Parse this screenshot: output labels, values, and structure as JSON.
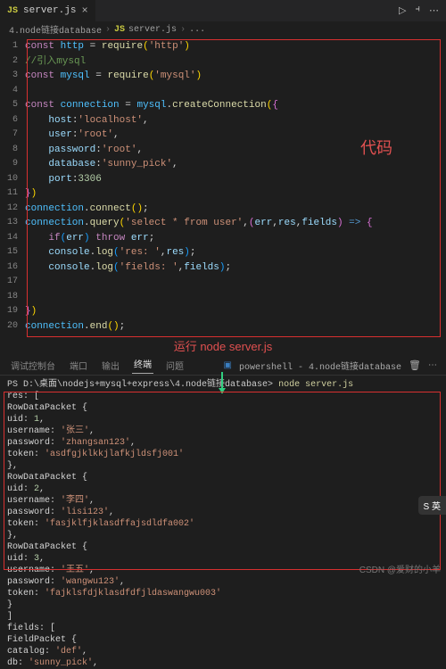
{
  "tab": {
    "filename": "server.js",
    "icon": "JS"
  },
  "breadcrumb": {
    "folder": "4.node链接database",
    "file": "server.js",
    "trail": "..."
  },
  "annotations": {
    "code_label": "代码",
    "run_label": "运行 node server.js"
  },
  "code_lines": [
    {
      "n": 1,
      "html": "<span class='kw'>const</span> <span class='const2'>http</span> <span class='punc'>=</span> <span class='fn'>require</span><span class='paren-y'>(</span><span class='str'>'http'</span><span class='paren-y'>)</span>"
    },
    {
      "n": 2,
      "html": "<span class='cmt'>//引入mysql</span>"
    },
    {
      "n": 3,
      "html": "<span class='kw'>const</span> <span class='const2'>mysql</span> <span class='punc'>=</span> <span class='fn'>require</span><span class='paren-y'>(</span><span class='str'>'mysql'</span><span class='paren-y'>)</span>"
    },
    {
      "n": 4,
      "html": ""
    },
    {
      "n": 5,
      "html": "<span class='kw'>const</span> <span class='const2'>connection</span> <span class='punc'>=</span> <span class='const2'>mysql</span><span class='punc'>.</span><span class='fn'>createConnection</span><span class='paren-y'>(</span><span class='paren-p'>{</span>"
    },
    {
      "n": 6,
      "html": "    <span class='ident'>host</span><span class='punc'>:</span><span class='str'>'localhost'</span><span class='punc'>,</span>"
    },
    {
      "n": 7,
      "html": "    <span class='ident'>user</span><span class='punc'>:</span><span class='str'>'root'</span><span class='punc'>,</span>"
    },
    {
      "n": 8,
      "html": "    <span class='ident'>password</span><span class='punc'>:</span><span class='str'>'root'</span><span class='punc'>,</span>"
    },
    {
      "n": 9,
      "html": "    <span class='ident'>database</span><span class='punc'>:</span><span class='str'>'sunny_pick'</span><span class='punc'>,</span>"
    },
    {
      "n": 10,
      "html": "    <span class='ident'>port</span><span class='punc'>:</span><span class='num'>3306</span>"
    },
    {
      "n": 11,
      "html": "<span class='paren-p'>}</span><span class='paren-y'>)</span>"
    },
    {
      "n": 12,
      "html": "<span class='const2'>connection</span><span class='punc'>.</span><span class='fn'>connect</span><span class='paren-y'>()</span><span class='punc'>;</span>"
    },
    {
      "n": 13,
      "html": "<span class='const2'>connection</span><span class='punc'>.</span><span class='fn'>query</span><span class='paren-y'>(</span><span class='str'>'select * from user'</span><span class='punc'>,</span><span class='paren-p'>(</span><span class='ident'>err</span><span class='punc'>,</span><span class='ident'>res</span><span class='punc'>,</span><span class='ident'>fields</span><span class='paren-p'>)</span> <span class='var'>=&gt;</span> <span class='paren-p'>{</span>"
    },
    {
      "n": 14,
      "html": "    <span class='kw'>if</span><span class='paren-b'>(</span><span class='ident'>err</span><span class='paren-b'>)</span> <span class='kw'>throw</span> <span class='ident'>err</span><span class='punc'>;</span>"
    },
    {
      "n": 15,
      "html": "    <span class='ident'>console</span><span class='punc'>.</span><span class='fn'>log</span><span class='paren-b'>(</span><span class='str'>'res: '</span><span class='punc'>,</span><span class='ident'>res</span><span class='paren-b'>)</span><span class='punc'>;</span>"
    },
    {
      "n": 16,
      "html": "    <span class='ident'>console</span><span class='punc'>.</span><span class='fn'>log</span><span class='paren-b'>(</span><span class='str'>'fields: '</span><span class='punc'>,</span><span class='ident'>fields</span><span class='paren-b'>)</span><span class='punc'>;</span>"
    },
    {
      "n": 17,
      "html": ""
    },
    {
      "n": 18,
      "html": ""
    },
    {
      "n": 19,
      "html": "<span class='paren-p'>}</span><span class='paren-y'>)</span>"
    },
    {
      "n": 20,
      "html": "<span class='const2'>connection</span><span class='punc'>.</span><span class='fn'>end</span><span class='paren-y'>()</span><span class='punc'>;</span>"
    }
  ],
  "terminal_tabs": {
    "items": [
      "调试控制台",
      "端口",
      "输出",
      "终端",
      "问题"
    ],
    "active_index": 3,
    "right_label": "powershell - 4.node链接database"
  },
  "terminal": {
    "prompt": "PS D:\\桌面\\nodejs+mysql+express\\4.node链接database>",
    "command": "node server.js",
    "output": [
      {
        "t": "res:  [",
        "c": "t-white"
      },
      {
        "t": "  RowDataPacket {",
        "c": "t-white"
      },
      {
        "t": "    uid: 1,",
        "c": "t-pale",
        "num": "1"
      },
      {
        "t": "    username: '张三',",
        "c": "t-pale",
        "str": "'张三'"
      },
      {
        "t": "    password: 'zhangsan123',",
        "c": "t-pale",
        "str": "'zhangsan123'"
      },
      {
        "t": "    token: 'asdfgjklkkjlafkjldsfj001'",
        "c": "t-pale",
        "str": "'asdfgjklkkjlafkjldsfj001'"
      },
      {
        "t": "  },",
        "c": "t-white"
      },
      {
        "t": "  RowDataPacket {",
        "c": "t-white"
      },
      {
        "t": "    uid: 2,",
        "c": "t-pale",
        "num": "2"
      },
      {
        "t": "    username: '李四',",
        "c": "t-pale",
        "str": "'李四'"
      },
      {
        "t": "    password: 'lisi123',",
        "c": "t-pale",
        "str": "'lisi123'"
      },
      {
        "t": "    token: 'fasjklfjklasdffajsdldfa002'",
        "c": "t-pale",
        "str": "'fasjklfjklasdffajsdldfa002'"
      },
      {
        "t": "  },",
        "c": "t-white"
      },
      {
        "t": "  RowDataPacket {",
        "c": "t-white"
      },
      {
        "t": "    uid: 3,",
        "c": "t-pale",
        "num": "3"
      },
      {
        "t": "    username: '王五',",
        "c": "t-pale",
        "str": "'王五'"
      },
      {
        "t": "    password: 'wangwu123',",
        "c": "t-pale",
        "str": "'wangwu123'"
      },
      {
        "t": "    token: 'fajklsfdjklasdfdfjldaswangwu003'",
        "c": "t-pale",
        "str": "'fajklsfdjklasdfdfjldaswangwu003'"
      },
      {
        "t": "  }",
        "c": "t-white"
      },
      {
        "t": "]",
        "c": "t-white"
      },
      {
        "t": "fields:  [",
        "c": "t-white"
      },
      {
        "t": "  FieldPacket {",
        "c": "t-white"
      },
      {
        "t": "    catalog: 'def',",
        "c": "t-pale",
        "str": "'def'"
      },
      {
        "t": "    db: 'sunny_pick',",
        "c": "t-pale",
        "str": "'sunny_pick'"
      }
    ]
  },
  "badge": "S 英",
  "watermark": "CSDN @爱财的小羊"
}
